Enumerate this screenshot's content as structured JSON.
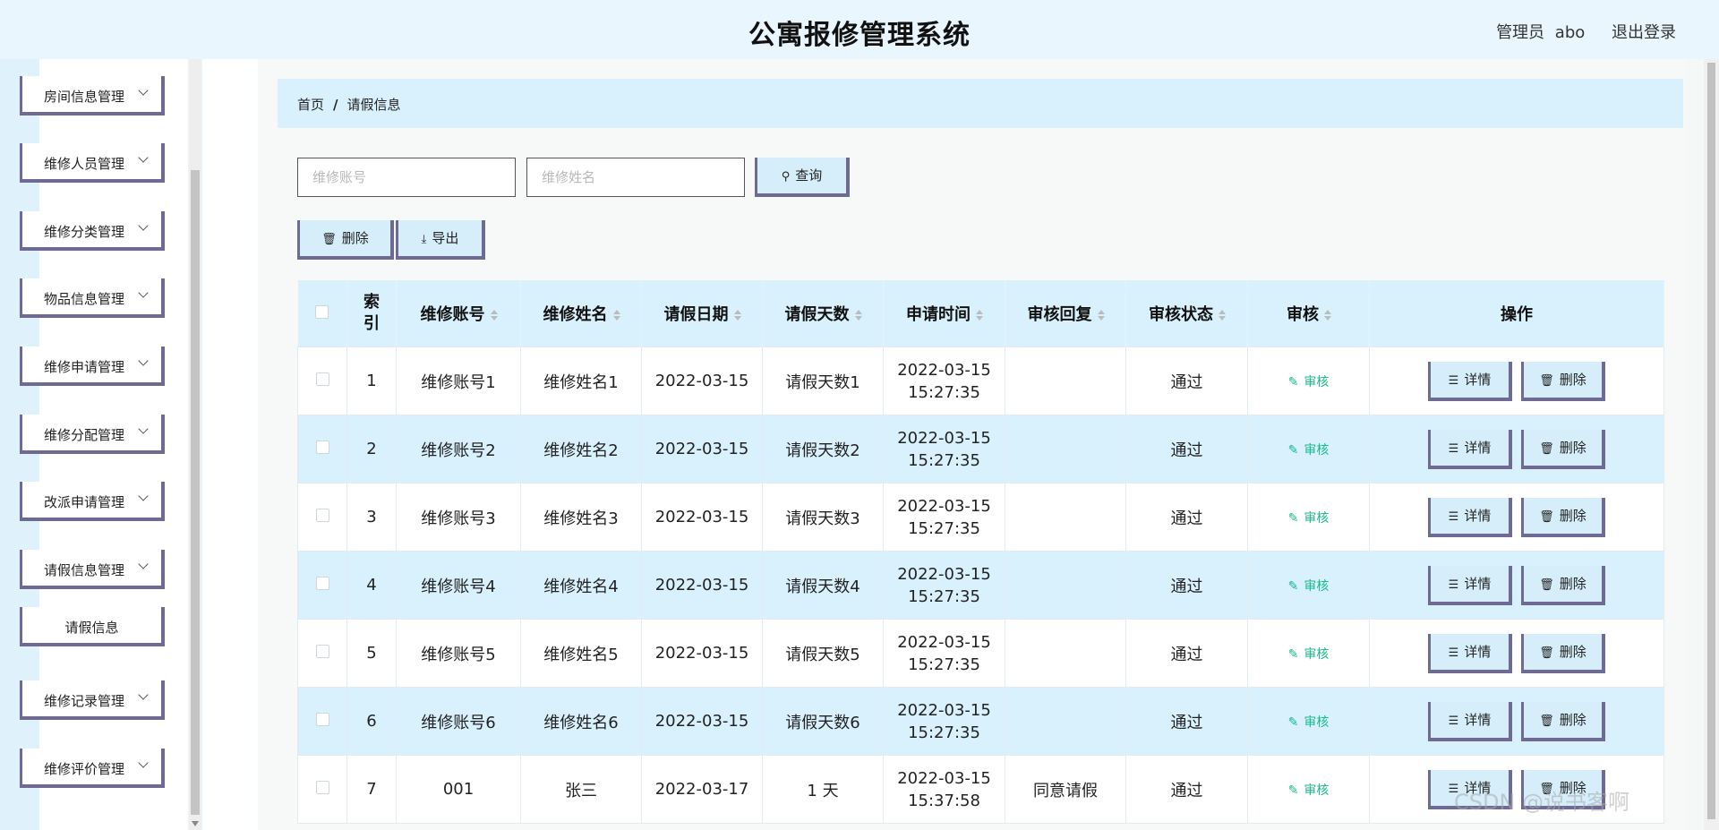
{
  "header": {
    "title": "公寓报修管理系统",
    "admin_role": "管理员",
    "admin_name": "abo",
    "logout": "退出登录"
  },
  "sidebar": {
    "items": [
      {
        "label": "房间信息管理"
      },
      {
        "label": "维修人员管理"
      },
      {
        "label": "维修分类管理"
      },
      {
        "label": "物品信息管理"
      },
      {
        "label": "维修申请管理"
      },
      {
        "label": "维修分配管理"
      },
      {
        "label": "改派申请管理"
      },
      {
        "label": "请假信息管理"
      },
      {
        "label": "请假信息"
      },
      {
        "label": "维修记录管理"
      },
      {
        "label": "维修评价管理"
      }
    ]
  },
  "breadcrumb": {
    "home": "首页",
    "separator": "/",
    "current": "请假信息"
  },
  "search": {
    "account_placeholder": "维修账号",
    "name_placeholder": "维修姓名",
    "query_label": "查询"
  },
  "toolbar": {
    "delete_label": "删除",
    "export_label": "导出"
  },
  "table": {
    "columns": {
      "index": "索引",
      "account": "维修账号",
      "name": "维修姓名",
      "leave_date": "请假日期",
      "leave_days": "请假天数",
      "apply_time": "申请时间",
      "reply": "审核回复",
      "status": "审核状态",
      "audit": "审核",
      "actions": "操作"
    },
    "audit_label": "审核",
    "detail_label": "详情",
    "delete_label": "删除",
    "rows": [
      {
        "index": "1",
        "account": "维修账号1",
        "name": "维修姓名1",
        "leave_date": "2022-03-15",
        "leave_days": "请假天数1",
        "apply_date": "2022-03-15",
        "apply_clock": "15:27:35",
        "reply": "",
        "status": "通过"
      },
      {
        "index": "2",
        "account": "维修账号2",
        "name": "维修姓名2",
        "leave_date": "2022-03-15",
        "leave_days": "请假天数2",
        "apply_date": "2022-03-15",
        "apply_clock": "15:27:35",
        "reply": "",
        "status": "通过"
      },
      {
        "index": "3",
        "account": "维修账号3",
        "name": "维修姓名3",
        "leave_date": "2022-03-15",
        "leave_days": "请假天数3",
        "apply_date": "2022-03-15",
        "apply_clock": "15:27:35",
        "reply": "",
        "status": "通过"
      },
      {
        "index": "4",
        "account": "维修账号4",
        "name": "维修姓名4",
        "leave_date": "2022-03-15",
        "leave_days": "请假天数4",
        "apply_date": "2022-03-15",
        "apply_clock": "15:27:35",
        "reply": "",
        "status": "通过"
      },
      {
        "index": "5",
        "account": "维修账号5",
        "name": "维修姓名5",
        "leave_date": "2022-03-15",
        "leave_days": "请假天数5",
        "apply_date": "2022-03-15",
        "apply_clock": "15:27:35",
        "reply": "",
        "status": "通过"
      },
      {
        "index": "6",
        "account": "维修账号6",
        "name": "维修姓名6",
        "leave_date": "2022-03-15",
        "leave_days": "请假天数6",
        "apply_date": "2022-03-15",
        "apply_clock": "15:27:35",
        "reply": "",
        "status": "通过"
      },
      {
        "index": "7",
        "account": "001",
        "name": "张三",
        "leave_date": "2022-03-17",
        "leave_days": "1 天",
        "apply_date": "2022-03-15",
        "apply_clock": "15:37:58",
        "reply": "同意请假",
        "status": "通过"
      }
    ]
  },
  "watermark": "CSDN @说书客啊"
}
